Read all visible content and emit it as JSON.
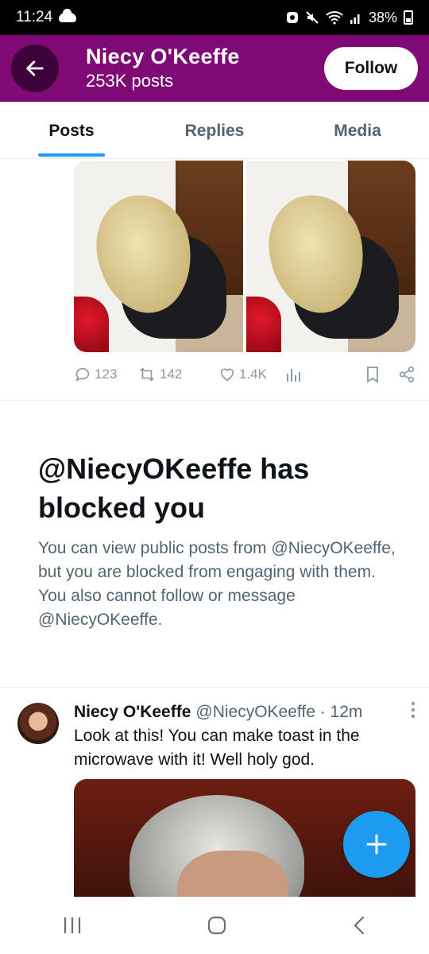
{
  "status_bar": {
    "time": "11:24",
    "battery": "38%"
  },
  "header": {
    "name": "Niecy O'Keeffe",
    "post_count": "253K posts",
    "follow_label": "Follow",
    "background_color": "#7f0a75"
  },
  "tabs": [
    {
      "label": "Posts",
      "active": true
    },
    {
      "label": "Replies",
      "active": false
    },
    {
      "label": "Media",
      "active": false
    }
  ],
  "media_post": {
    "replies": "123",
    "reposts": "142",
    "likes": "1.4K"
  },
  "blocked": {
    "title": "@NiecyOKeeffe has blocked you",
    "body": "You can view public posts from @NiecyOKeeffe, but you are blocked from engaging with them. You also cannot follow or message @NiecyOKeeffe."
  },
  "post2": {
    "name": "Niecy O'Keeffe",
    "meta": "@NiecyOKeeffe · 12m",
    "text": "Look at this! You can make toast in the microwave with it! Well holy god."
  },
  "colors": {
    "accent": "#1d9bf0",
    "secondary_text": "#536471"
  }
}
